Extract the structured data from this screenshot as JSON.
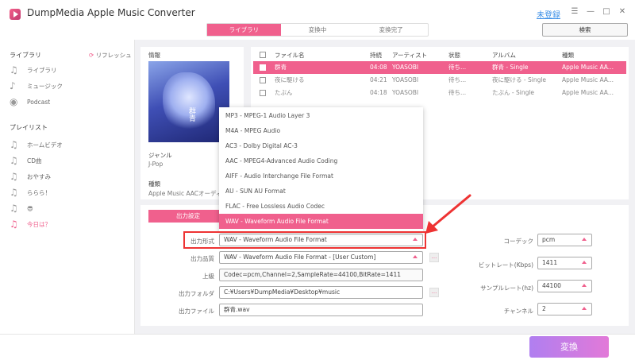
{
  "app": {
    "title": "DumpMedia Apple Music Converter",
    "register": "未登録"
  },
  "window": {
    "menu": "☰",
    "minimize": "—",
    "maximize": "□",
    "close": "✕"
  },
  "tabs": [
    {
      "label": "ライブラリ"
    },
    {
      "label": "変換中"
    },
    {
      "label": "変換完了"
    }
  ],
  "search_label": "検索",
  "sidebar": {
    "library_heading": "ライブラリ",
    "refresh": "リフレッシュ",
    "library": [
      {
        "label": "ライブラリ",
        "icon": "music-notes-icon"
      },
      {
        "label": "ミュージック",
        "icon": "music-note-icon"
      },
      {
        "label": "Podcast",
        "icon": "podcast-icon"
      }
    ],
    "playlist_heading": "プレイリスト",
    "playlists": [
      {
        "label": "ホームビデオ"
      },
      {
        "label": "CD曲"
      },
      {
        "label": "おやすみ"
      },
      {
        "label": "ららら！"
      },
      {
        "label": "😎"
      },
      {
        "label": "今日は？"
      }
    ]
  },
  "info": {
    "heading": "情報",
    "cover_text": "群青",
    "genre_label": "ジャンル",
    "genre_value": "J-Pop",
    "kind_label": "種類",
    "kind_value": "Apple Music AACオーディオ"
  },
  "table": {
    "headers": {
      "name": "ファイル名",
      "duration": "持続",
      "artist": "アーティスト",
      "status": "状態",
      "album": "アルバム",
      "kind": "種類"
    },
    "rows": [
      {
        "name": "群青",
        "duration": "04:08",
        "artist": "YOASOBI",
        "status": "待ち...",
        "album": "群青 - Single",
        "kind": "Apple Music AA..."
      },
      {
        "name": "夜に駆ける",
        "duration": "04:21",
        "artist": "YOASOBI",
        "status": "待ち...",
        "album": "夜に駆ける - Single",
        "kind": "Apple Music AA..."
      },
      {
        "name": "たぶん",
        "duration": "04:18",
        "artist": "YOASOBI",
        "status": "待ち...",
        "album": "たぶん - Single",
        "kind": "Apple Music AA..."
      }
    ]
  },
  "dropdown": {
    "options": [
      "MP3 - MPEG-1 Audio Layer 3",
      "M4A - MPEG Audio",
      "AC3 - Dolby Digital AC-3",
      "AAC - MPEG4-Advanced Audio Coding",
      "AIFF - Audio Interchange File Format",
      "AU - SUN AU Format",
      "FLAC - Free Lossless Audio Codec",
      "WAV - Waveform Audio File Format"
    ]
  },
  "settings": {
    "tab_label": "出力設定",
    "format_label": "出力形式",
    "format_value": "WAV - Waveform Audio File Format",
    "quality_label": "出力品質",
    "quality_value": "WAV - Waveform Audio File Format - [User Custom]",
    "detail_label": "上級",
    "detail_value": "Codec=pcm,Channel=2,SampleRate=44100,BitRate=1411",
    "folder_label": "出力フォルダ",
    "folder_value": "C:¥Users¥DumpMedia¥Desktop¥music",
    "file_label": "出力ファイル",
    "file_value": "群青.wav",
    "codec_label": "コーデック",
    "codec_value": "pcm",
    "bitrate_label": "ビットレート(Kbps)",
    "bitrate_value": "1411",
    "samplerate_label": "サンプルレート(hz)",
    "samplerate_value": "44100",
    "channel_label": "チャンネル",
    "channel_value": "2",
    "small_btn": "..."
  },
  "convert_label": "変換",
  "colors": {
    "accent": "#f0608d",
    "highlight": "#ee3333"
  }
}
